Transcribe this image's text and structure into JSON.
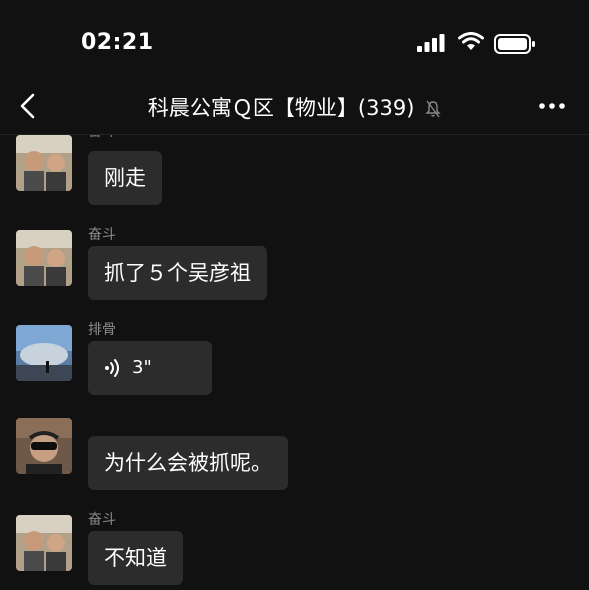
{
  "status_bar": {
    "time": "02:21",
    "icons": [
      "signal-icon",
      "wifi-icon",
      "battery-icon"
    ]
  },
  "header": {
    "back_icon": "chevron-left-icon",
    "title": "科晨公寓Ｑ区【物业】(339)",
    "mute_icon": "bell-off-icon",
    "more_icon": "more-horizontal-icon"
  },
  "messages": [
    {
      "sender": "奋斗",
      "text": "刚走",
      "avatar": "two-men-selfie"
    },
    {
      "sender": "奋斗",
      "text": "抓了５个吴彦祖",
      "avatar": "two-men-selfie"
    },
    {
      "sender": "排骨",
      "type": "voice",
      "duration": "3\"",
      "avatar": "sky-landscape"
    },
    {
      "sender": "",
      "text": "为什么会被抓呢。",
      "avatar": "man-sunglasses"
    },
    {
      "sender": "奋斗",
      "text": "不知道",
      "avatar": "two-men-selfie"
    }
  ],
  "colors": {
    "background": "#111111",
    "bubble": "#2c2c2c",
    "sender_text": "#8a8a8a"
  }
}
